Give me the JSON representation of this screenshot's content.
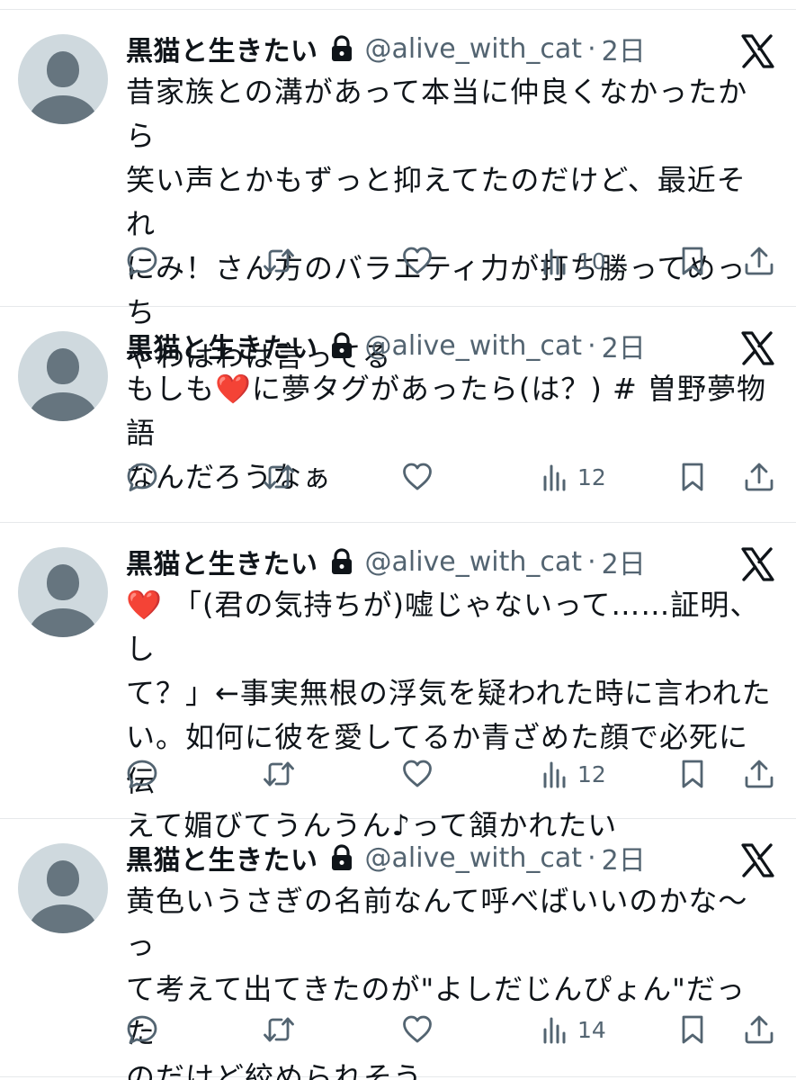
{
  "colors": {
    "text": "#0f1419",
    "muted": "#536471",
    "divider": "#e6e9eb",
    "avatar_bg": "#cfd9de",
    "avatar_fg": "#66757f"
  },
  "tweets": [
    {
      "name": "黒猫と生きたい",
      "handle": "@alive_with_cat",
      "sep": "·",
      "time": "2日",
      "lines": [
        "昔家族との溝があって本当に仲良くなかったから",
        "笑い声とかもずっと抑えてたのだけど、最近それ",
        "にみ！さん方のバラエティ力が打ち勝ってめっち",
        "ゃわはわは言ってる"
      ],
      "views": "10"
    },
    {
      "name": "黒猫と生きたい",
      "handle": "@alive_with_cat",
      "sep": "·",
      "time": "2日",
      "lines": [
        "もしも❤️に夢タグがあったら(は？) # 曽野夢物語",
        "なんだろうなぁ"
      ],
      "views": "12"
    },
    {
      "name": "黒猫と生きたい",
      "handle": "@alive_with_cat",
      "sep": "·",
      "time": "2日",
      "lines": [
        "❤️ 「(君の気持ちが)嘘じゃないって……証明、し",
        "て？」←事実無根の浮気を疑われた時に言われた",
        "い。如何に彼を愛してるか青ざめた顔で必死に伝",
        "えて媚びてうんうん♪って頷かれたい"
      ],
      "views": "12"
    },
    {
      "name": "黒猫と生きたい",
      "handle": "@alive_with_cat",
      "sep": "·",
      "time": "2日",
      "lines": [
        "黄色いうさぎの名前なんて呼べばいいのかな〜っ",
        "て考えて出てきたのが\"よしだじんぴょん\"だった",
        "のだけど絞められそう"
      ],
      "views": "14"
    }
  ],
  "icons": [
    "lock-icon",
    "x-logo-icon",
    "reply-icon",
    "retweet-icon",
    "like-icon",
    "views-icon",
    "bookmark-icon",
    "share-icon"
  ]
}
